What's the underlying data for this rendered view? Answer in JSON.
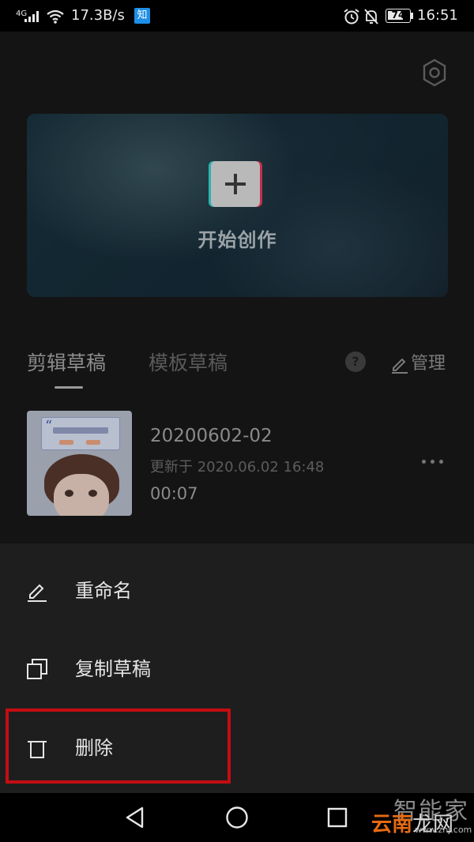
{
  "status_bar": {
    "network": "4G",
    "speed": "17.3B/s",
    "zhihu_badge": "知",
    "battery": "74",
    "battery_level": 0.74,
    "time": "16:51",
    "icons": [
      "signal-icon",
      "wifi-icon",
      "alarm-icon",
      "bell-mute-icon",
      "battery-icon"
    ]
  },
  "settings_icon": "gear-icon",
  "hero": {
    "label": "开始创作",
    "icon": "plus-icon"
  },
  "tabs": [
    {
      "label": "剪辑草稿",
      "active": true
    },
    {
      "label": "模板草稿",
      "active": false
    }
  ],
  "help_glyph": "?",
  "manage": {
    "label": "管理",
    "icon": "pencil-icon"
  },
  "draft": {
    "title": "20200602-02",
    "updated": "更新于 2020.06.02 16:48",
    "duration": "00:07",
    "more_icon": "more-dots-icon"
  },
  "sheet": {
    "items": [
      {
        "label": "重命名",
        "icon": "pencil-icon"
      },
      {
        "label": "复制草稿",
        "icon": "copy-icon"
      },
      {
        "label": "删除",
        "icon": "trash-icon"
      }
    ],
    "highlight_color": "#c40d12"
  },
  "nav_bar": {
    "buttons": [
      "back-icon",
      "home-icon",
      "recents-icon"
    ]
  },
  "watermark": {
    "line1": "智能家",
    "line2_orange": "云南",
    "line2_gray": "龙网",
    "line3": "www.znj.com"
  }
}
